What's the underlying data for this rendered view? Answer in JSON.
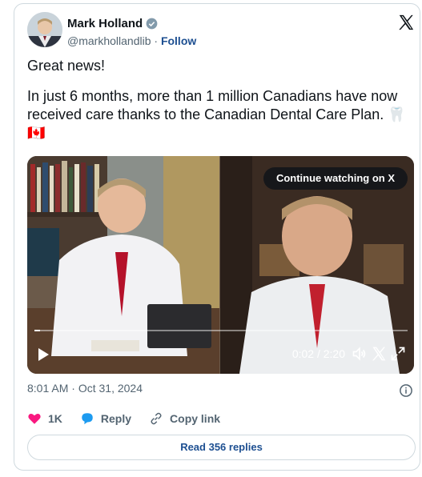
{
  "author": {
    "name": "Mark Holland",
    "handle": "@markhollandlib",
    "separator": "·",
    "follow_label": "Follow"
  },
  "tweet": {
    "line1": "Great news!",
    "line2": "In just 6 months, more than 1 million Canadians have now received care thanks to the Canadian Dental Care Plan. 🦷",
    "line3": "🇨🇦"
  },
  "video": {
    "continue_label": "Continue watching on X",
    "current_time": "0:02",
    "time_separator": "/",
    "duration": "2:20",
    "progress_fraction": 0.015
  },
  "meta": {
    "time": "8:01 AM",
    "separator": "·",
    "date": "Oct 31, 2024"
  },
  "actions": {
    "likes": "1K",
    "reply_label": "Reply",
    "copy_label": "Copy link"
  },
  "read_replies_label": "Read 356 replies",
  "colors": {
    "link": "#1d4f91",
    "like": "#f91880",
    "reply": "#1d9bf0",
    "muted": "#536471",
    "border": "#cfd9de"
  },
  "icons": [
    "verified-badge-icon",
    "x-logo-icon",
    "play-icon",
    "volume-icon",
    "x-small-icon",
    "fullscreen-icon",
    "info-icon",
    "heart-icon",
    "reply-bubble-icon",
    "link-icon"
  ]
}
